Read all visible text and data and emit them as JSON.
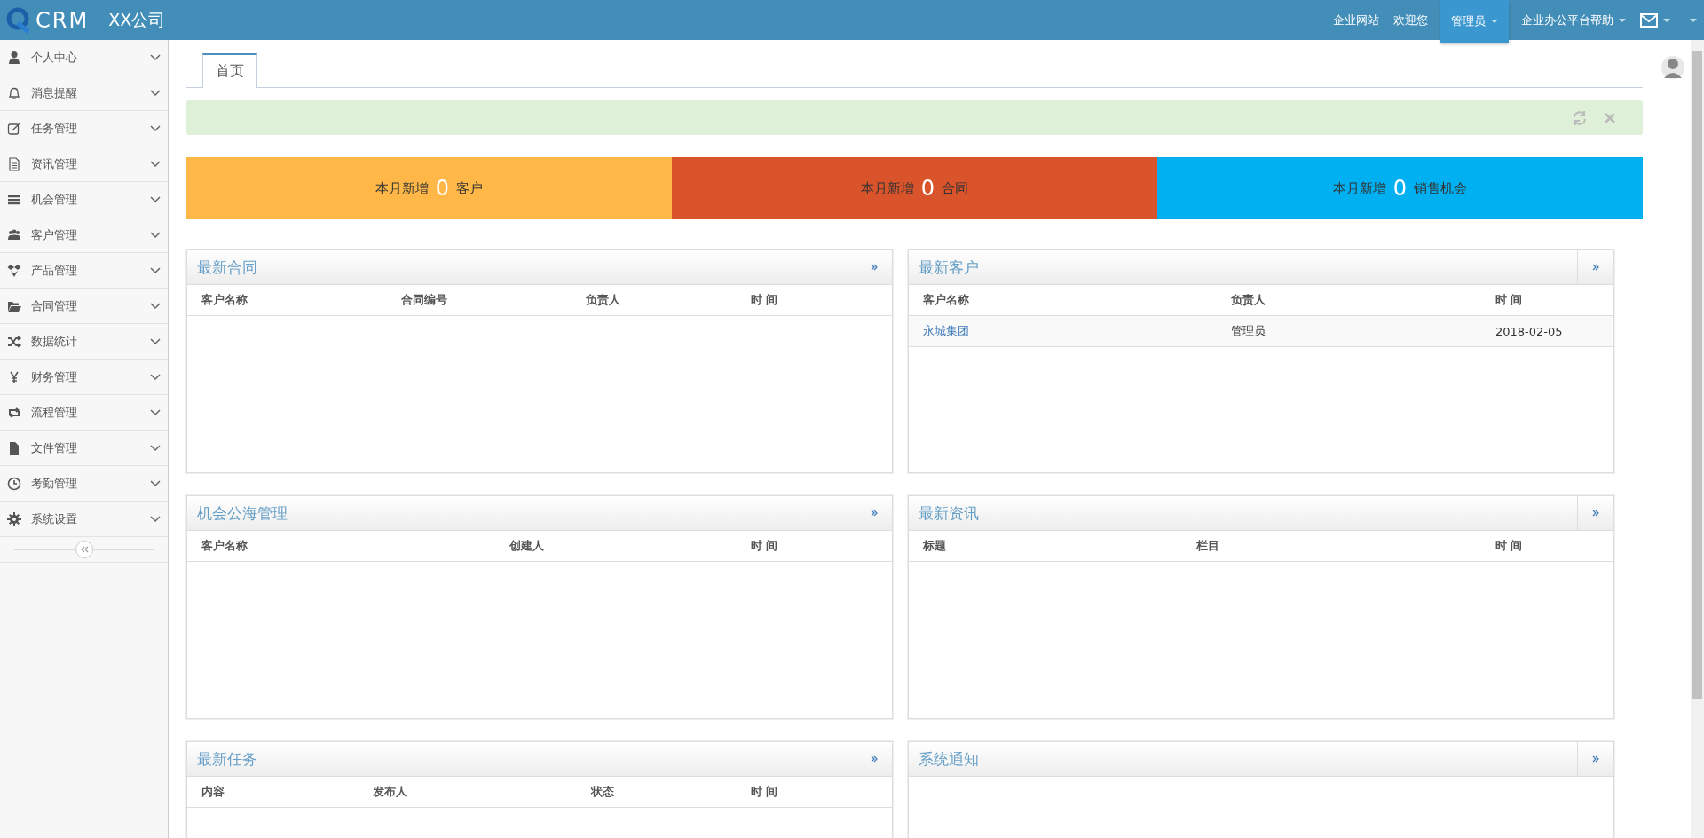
{
  "header": {
    "logo_text": "CRM",
    "company": "XX公司",
    "nav": [
      {
        "label": "企业网站",
        "dropdown": false,
        "selected": false
      },
      {
        "label": "欢迎您",
        "dropdown": false,
        "selected": false
      },
      {
        "label": "管理员",
        "dropdown": true,
        "selected": true
      },
      {
        "label": "企业办公平台帮助",
        "dropdown": true,
        "selected": false
      }
    ]
  },
  "sidebar": {
    "items": [
      {
        "label": "个人中心",
        "expanded": false
      },
      {
        "label": "消息提醒",
        "expanded": false
      },
      {
        "label": "任务管理",
        "expanded": false
      },
      {
        "label": "资讯管理",
        "expanded": false
      },
      {
        "label": "机会管理",
        "expanded": false
      },
      {
        "label": "客户管理",
        "expanded": false
      },
      {
        "label": "产品管理",
        "expanded": false
      },
      {
        "label": "合同管理",
        "expanded": false
      },
      {
        "label": "数据统计",
        "expanded": false
      },
      {
        "label": "财务管理",
        "expanded": false
      },
      {
        "label": "流程管理",
        "expanded": false
      },
      {
        "label": "文件管理",
        "expanded": false
      },
      {
        "label": "考勤管理",
        "expanded": false
      },
      {
        "label": "系统设置",
        "expanded": false
      }
    ]
  },
  "tabs": [
    {
      "label": "首页",
      "selected": true
    }
  ],
  "stats": [
    {
      "prefix": "本月新增",
      "count": "0",
      "suffix": "客户",
      "color": "#ffb848"
    },
    {
      "prefix": "本月新增",
      "count": "0",
      "suffix": "合同",
      "color": "#d9542b"
    },
    {
      "prefix": "本月新增",
      "count": "0",
      "suffix": "销售机会",
      "color": "#00b0f0"
    }
  ],
  "panels": [
    {
      "title": "最新合同",
      "columns": [
        "客户名称",
        "合同编号",
        "负责人",
        "时 间"
      ]
    },
    {
      "title": "最新客户",
      "columns": [
        "客户名称",
        "负责人",
        "时 间"
      ],
      "rows": [
        [
          "永城集团",
          "管理员",
          "2018-02-05"
        ]
      ]
    },
    {
      "title": "机会公海管理",
      "columns": [
        "客户名称",
        "创建人",
        "时 间"
      ]
    },
    {
      "title": "最新资讯",
      "columns": [
        "标题",
        "栏目",
        "时 间"
      ]
    },
    {
      "title": "最新任务",
      "columns": [
        "内容",
        "发布人",
        "状态",
        "时 间"
      ]
    },
    {
      "title": "系统通知"
    }
  ]
}
